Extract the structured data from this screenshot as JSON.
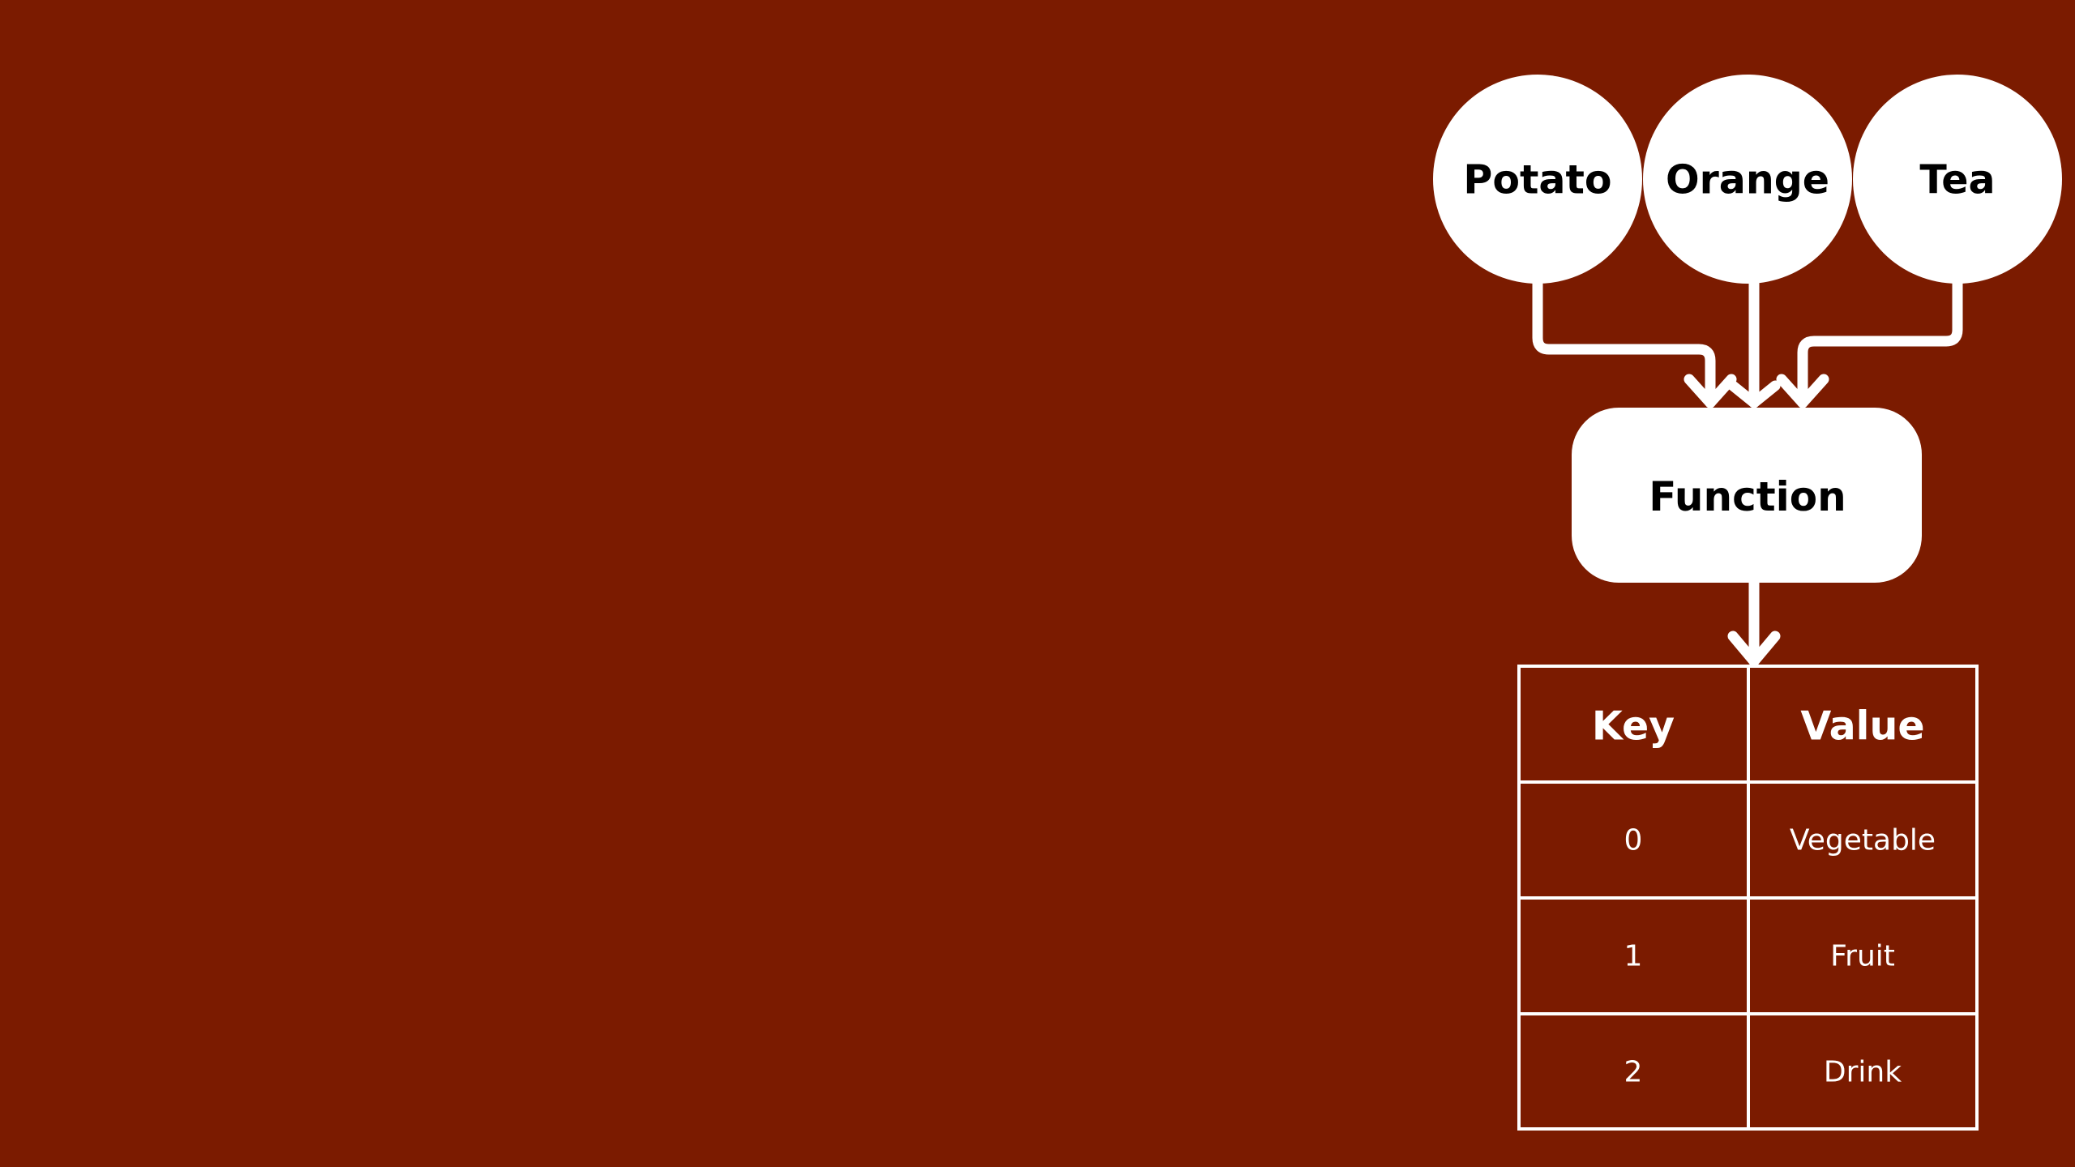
{
  "colors": {
    "background": "#7b1b00",
    "foreground": "#ffffff",
    "label_dark": "#000000"
  },
  "inputs": [
    {
      "label": "Potato"
    },
    {
      "label": "Orange"
    },
    {
      "label": "Tea"
    }
  ],
  "function": {
    "label": "Function"
  },
  "table": {
    "headers": [
      "Key",
      "Value"
    ],
    "rows": [
      [
        "0",
        "Vegetable"
      ],
      [
        "1",
        "Fruit"
      ],
      [
        "2",
        "Drink"
      ]
    ]
  }
}
